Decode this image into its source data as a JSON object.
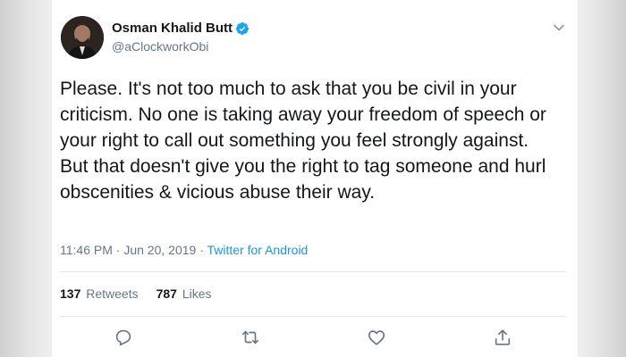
{
  "tweet": {
    "author": {
      "display_name": "Osman Khalid Butt",
      "handle": "@aClockworkObi",
      "verified": true
    },
    "text_lines": [
      "Please. It's not too much to ask that you be civil in your criticism. No one is taking away your freedom of speech or your right to call out something you feel strongly against.",
      "But that doesn't give you the right to tag someone and hurl obscenities & vicious abuse their way."
    ],
    "time": "11:46 PM",
    "date": "Jun 20, 2019",
    "separator_1": " · ",
    "separator_2": " · ",
    "source": "Twitter for Android",
    "retweets_count": "137",
    "retweets_label": "Retweets",
    "likes_count": "787",
    "likes_label": "Likes"
  },
  "icons": {
    "reply": "reply-icon",
    "retweet": "retweet-icon",
    "like": "like-icon",
    "share": "share-icon",
    "verified": "verified-badge-icon",
    "more": "chevron-down-icon"
  },
  "colors": {
    "link": "#1b95e0",
    "verified": "#1da1f2",
    "secondary_text": "#657786",
    "primary_text": "#14171a"
  }
}
